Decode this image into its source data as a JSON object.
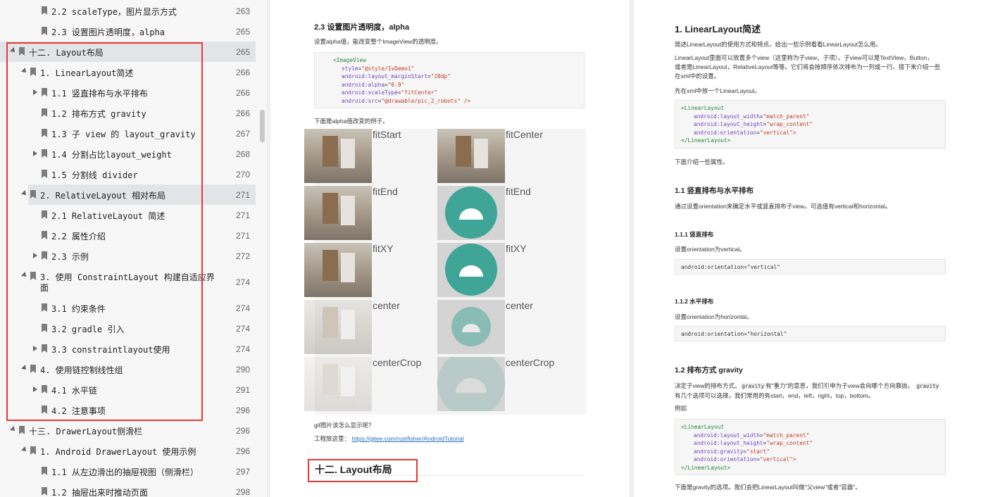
{
  "toc": {
    "items": [
      {
        "label": "2.2 scaleType，图片显示方式",
        "page": "263",
        "caret": "none",
        "depth": 3
      },
      {
        "label": "2.3 设置图片透明度，alpha",
        "page": "265",
        "caret": "none",
        "depth": 3
      },
      {
        "label": "十二. Layout布局",
        "page": "265",
        "caret": "open",
        "depth": 1,
        "selected": true
      },
      {
        "label": "1. LinearLayout简述",
        "page": "266",
        "caret": "open",
        "depth": 2
      },
      {
        "label": "1.1 竖直排布与水平排布",
        "page": "266",
        "caret": "closed",
        "depth": 3
      },
      {
        "label": "1.2 排布方式 gravity",
        "page": "266",
        "caret": "none",
        "depth": 3
      },
      {
        "label": "1.3 子 view 的 layout_gravity",
        "page": "267",
        "caret": "none",
        "depth": 3
      },
      {
        "label": "1.4 分割占比layout_weight",
        "page": "268",
        "caret": "closed",
        "depth": 3
      },
      {
        "label": "1.5 分割线 divider",
        "page": "270",
        "caret": "none",
        "depth": 3
      },
      {
        "label": "2. RelativeLayout 相对布局",
        "page": "271",
        "caret": "open",
        "depth": 2,
        "selected": true
      },
      {
        "label": "2.1 RelativeLayout 简述",
        "page": "271",
        "caret": "none",
        "depth": 3
      },
      {
        "label": "2.2 属性介绍",
        "page": "271",
        "caret": "none",
        "depth": 3
      },
      {
        "label": "2.3 示例",
        "page": "272",
        "caret": "closed",
        "depth": 3
      },
      {
        "label": "3. 使用 ConstraintLayout 构建自适应界",
        "label2": "面",
        "page": "274",
        "caret": "open",
        "depth": 2
      },
      {
        "label": "3.1 约束条件",
        "page": "274",
        "caret": "none",
        "depth": 3
      },
      {
        "label": "3.2 gradle 引入",
        "page": "274",
        "caret": "none",
        "depth": 3
      },
      {
        "label": "3.3 constraintlayout使用",
        "page": "274",
        "caret": "closed",
        "depth": 3
      },
      {
        "label": "4. 使用链控制线性组",
        "page": "290",
        "caret": "open",
        "depth": 2
      },
      {
        "label": "4.1 水平链",
        "page": "291",
        "caret": "closed",
        "depth": 3
      },
      {
        "label": "4.2 注意事项",
        "page": "296",
        "caret": "none",
        "depth": 3
      },
      {
        "label": "十三. DrawerLayout侧滑栏",
        "page": "296",
        "caret": "open",
        "depth": 1
      },
      {
        "label": "1. Android DrawerLayout 使用示例",
        "page": "296",
        "caret": "open",
        "depth": 2
      },
      {
        "label": "1.1 从左边滑出的抽屉视图（侧滑栏）",
        "page": "297",
        "caret": "none",
        "depth": 3
      },
      {
        "label": "1.2 抽屉出来时推动页面",
        "page": "298",
        "caret": "none",
        "depth": 3
      }
    ]
  },
  "left_page": {
    "heading": "2.3 设置图片透明度，alpha",
    "intro": "设置alpha值，能改变整个ImageView的透明度。",
    "code": {
      "tag_open": "<ImageView",
      "lines": [
        {
          "attr": "style",
          "value": "\"@style/IvDemo1\""
        },
        {
          "attr": "android:layout_marginStart",
          "value": "\"20dp\""
        },
        {
          "attr": "android:alpha",
          "value": "\"0.9\""
        },
        {
          "attr": "android:scaleType",
          "value": "\"fitCenter\""
        },
        {
          "attr": "android:src",
          "value": "\"@drawable/pic_2_robots\" />"
        }
      ]
    },
    "example_caption": "下面是alpha值改变的例子。",
    "grid": {
      "rows": [
        {
          "left": "fitStart",
          "right": "fitCenter"
        },
        {
          "left": "fitEnd",
          "right": "fitEnd"
        },
        {
          "left": "fitXY",
          "right": "fitXY"
        },
        {
          "left": "center",
          "right": "center"
        },
        {
          "left": "centerCrop",
          "right": "centerCrop"
        }
      ]
    },
    "gif_question": "gif图片该怎么显示呢？",
    "project_label": "工程放这里：",
    "project_link": "https://gitee.com/rustfisher/AndroidTutorial",
    "section_heading": "十二. Layout布局"
  },
  "right_page": {
    "h1": "1. LinearLayout简述",
    "p1": "简述LinearLayout的使用方式和特点。给出一些示例看看LinearLayout怎么用。",
    "p2a": "LinearLayout里面可以放置多个view（这里称为子view，子项）。子view可以是TextView，Button，",
    "p2b": "或者是LinearLayout，RelativeLayout等等。它们将会按顺序依次排布为一列或一行。接下来介绍一些",
    "p2c": "在xml中的设置。",
    "p3": "先在xml中放一个LinearLayout。",
    "code1": {
      "open": "<LinearLayout",
      "lines": [
        {
          "attr": "android:layout_width",
          "value": "\"match_parent\""
        },
        {
          "attr": "android:layout_height",
          "value": "\"wrap_content\""
        },
        {
          "attr": "android:orientation",
          "value": "\"vertical\">"
        }
      ],
      "close": "</LinearLayout>"
    },
    "p4": "下面介绍一些属性。",
    "h11": "1.1 竖直排布与水平排布",
    "p5": "通过设置orientation来确定水平或竖直排布子view。可选值有vertical和horizontal。",
    "h111": "1.1.1 竖直排布",
    "p6": "设置orientation为vertical。",
    "code2": "android:orientation=\"vertical\"",
    "h112": "1.1.2 水平排布",
    "p7": "设置orientation为horizontal。",
    "code3": "android:orientation=\"horizontal\"",
    "h12": "1.2 排布方式 gravity",
    "p8a": "决定子view的排布方式。",
    "p8code": "gravity",
    "p8b": "有\"重力\"的意思，我们引申为子view会向哪个方向靠拢。",
    "p8code2": "gravity",
    "p8c": "有几个选项可以选择，我们常用的有start，end，left，right，top，bottom。",
    "p9": "例如",
    "code4": {
      "open": "<LinearLayout",
      "lines": [
        {
          "attr": "android:layout_width",
          "value": "\"match_parent\""
        },
        {
          "attr": "android:layout_height",
          "value": "\"wrap_content\""
        },
        {
          "attr": "android:gravity",
          "value": "\"start\""
        },
        {
          "attr": "android:orientation",
          "value": "\"vertical\">"
        }
      ],
      "close": "</LinearLayout>"
    },
    "p10": "下面是gravity的选项。我们会把LinearLayout叫做\"父view\"或者\"容器\"。"
  },
  "colors": {
    "highlight_border": "#e53935",
    "selected_row": "#e2e4e8",
    "android_teal": "#3ea597",
    "link": "#2a6fbb"
  }
}
